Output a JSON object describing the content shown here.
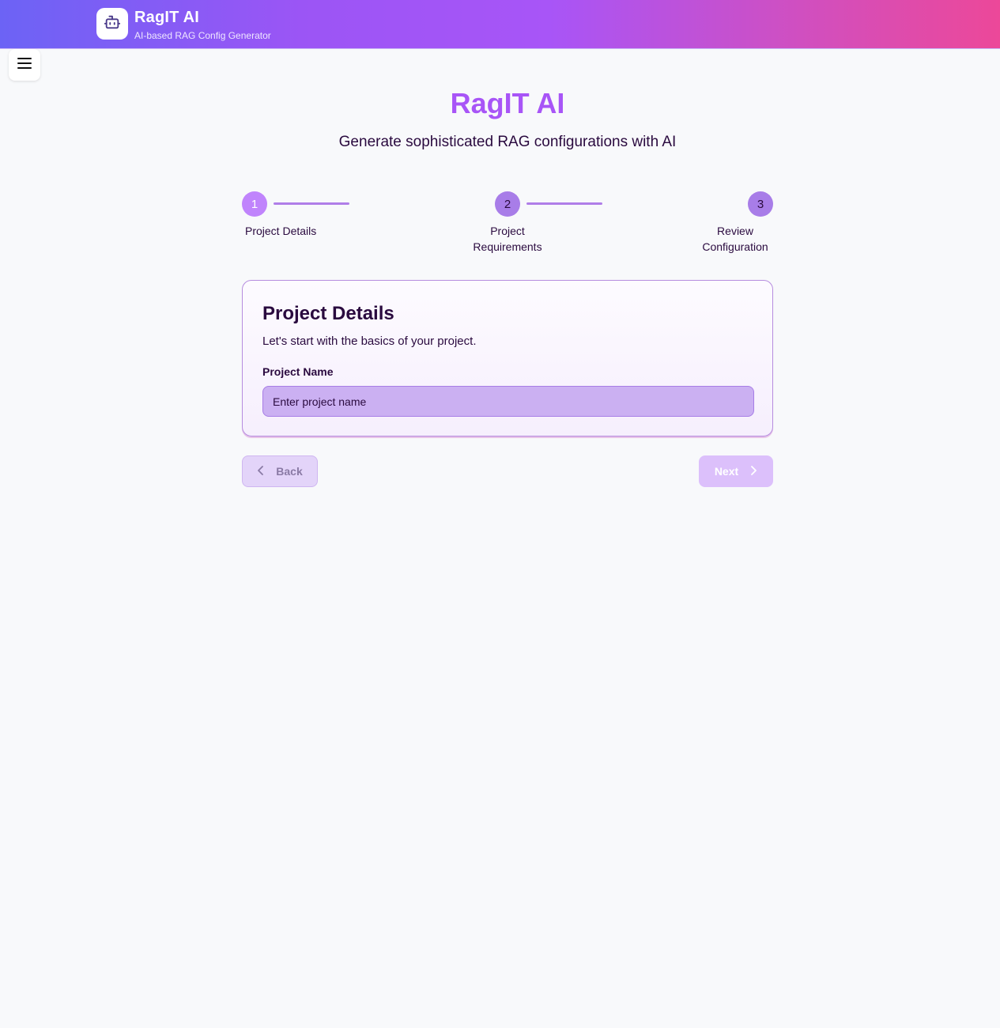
{
  "header": {
    "logo_icon": "robot-icon",
    "title": "RagIT AI",
    "subtitle": "AI-based RAG Config Generator"
  },
  "menu": {
    "icon": "hamburger-menu-icon"
  },
  "hero": {
    "title": "RagIT AI",
    "subtitle": "Generate sophisticated RAG configurations with AI"
  },
  "stepper": {
    "steps": [
      {
        "number": "1",
        "label": "Project Details",
        "state": "active"
      },
      {
        "number": "2",
        "label_line1": "Project",
        "label_line2": "Requirements",
        "state": "upcoming"
      },
      {
        "number": "3",
        "label_line1": "Review",
        "label_line2": "Configuration",
        "state": "upcoming"
      }
    ]
  },
  "card": {
    "title": "Project Details",
    "description": "Let's start with the basics of your project.",
    "field_label": "Project Name",
    "field_placeholder": "Enter project name",
    "field_value": ""
  },
  "nav": {
    "back_label": "Back",
    "back_icon": "chevron-left-icon",
    "next_label": "Next",
    "next_icon": "chevron-right-icon"
  },
  "colors": {
    "accent": "#a855f7",
    "header_gradient_start": "#6c63f5",
    "header_gradient_end": "#ec4899",
    "text_dark": "#2a0a3f"
  }
}
